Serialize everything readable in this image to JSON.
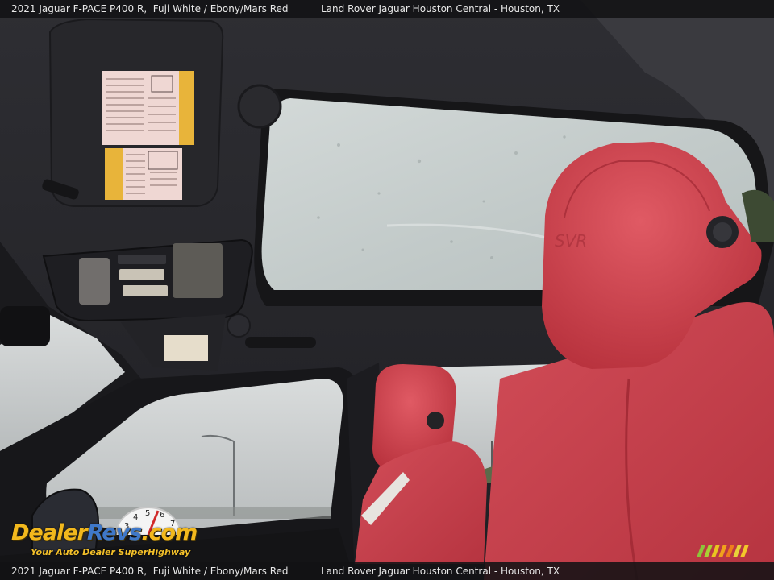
{
  "caption": {
    "vehicle": "2021 Jaguar F-PACE P400 R,",
    "colors": "Fuji White / Ebony/Mars Red",
    "dealer": "Land Rover Jaguar Houston Central - Houston, TX"
  },
  "watermark": {
    "brand_part1": "Dealer",
    "brand_part2": "Revs",
    "brand_suffix": ".com",
    "tagline": "Your Auto Dealer SuperHighway",
    "gauge_digits": "3 4 5 6 7"
  },
  "colors": {
    "caption_bg": "#121214",
    "upholstery_red": "#c8424d",
    "headliner": "#2a2a2e",
    "sky": "#c9cfcf",
    "brand_yellow": "#f2b81d",
    "brand_blue": "#3f78c9"
  },
  "icons": [
    "warning-label",
    "map-light",
    "sunroof",
    "headrest",
    "side-mirror",
    "street-lamp"
  ]
}
